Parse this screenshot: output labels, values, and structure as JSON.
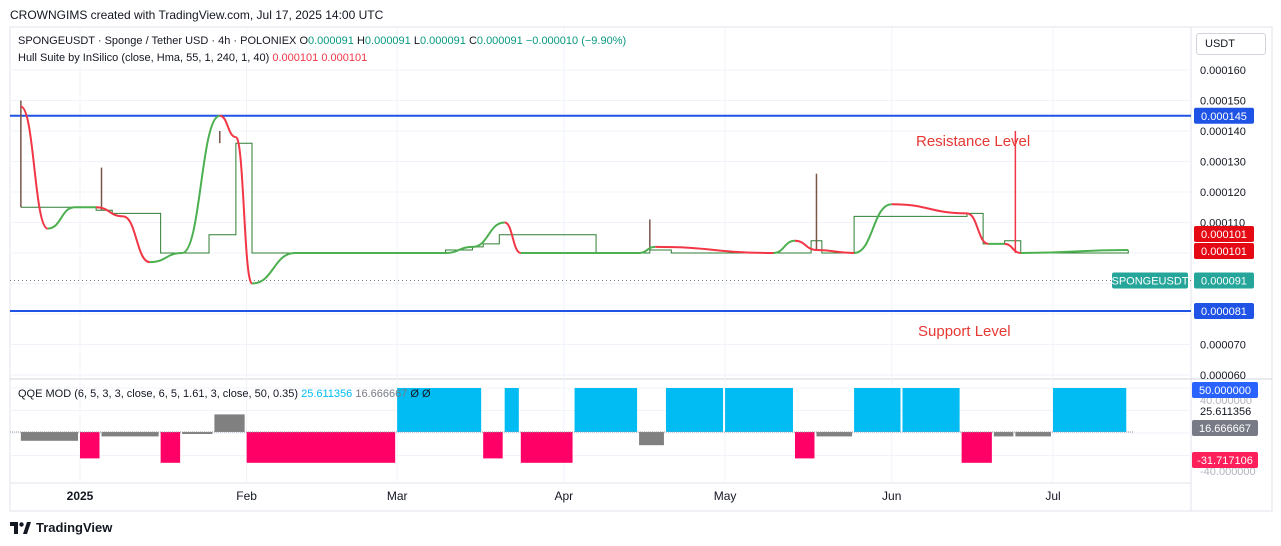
{
  "header": {
    "credit": "CROWNGIMS created with TradingView.com, Jul 17, 2025 14:00 UTC"
  },
  "legend": {
    "symbol": "SPONGEUSDT · Sponge / Tether USD · 4h · POLONIEX",
    "o_label": "O",
    "o": "0.000091",
    "h_label": "H",
    "h": "0.000091",
    "l_label": "L",
    "l": "0.000091",
    "c_label": "C",
    "c": "0.000091",
    "change": "−0.000010 (−9.90%)",
    "hull_name": "Hull Suite by InSilico (close, Hma, 55, 1, 240, 1, 40)",
    "hull_v1": "0.000101",
    "hull_v2": "0.000101",
    "qqe_name": "QQE MOD (6, 5, 3, 3, close, 6, 5, 1.61, 3, close, 50, 0.35)",
    "qqe_v1": "25.611356",
    "qqe_v2": "16.666667",
    "qqe_icons": "Ø Ø"
  },
  "price_axis": {
    "currency": "USDT",
    "ticks": [
      "0.000160",
      "0.000150",
      "0.000140",
      "0.000130",
      "0.000120",
      "0.000110",
      "0.000070",
      "0.000060"
    ],
    "resistance_label": "0.000145",
    "support_label": "0.000081",
    "hull_label1": "0.000101",
    "hull_label2": "0.000101",
    "symbol_tag": "SPONGEUSDT",
    "last_price": "0.000091"
  },
  "annotations": {
    "resistance": "Resistance Level",
    "support": "Support Level"
  },
  "qqe_axis": {
    "top_label": "50.000000",
    "tick1": "25.611356",
    "mid_label": "16.666667",
    "bottom_label": "-31.717106",
    "hidden_tick": "40.000000",
    "hidden_tick2": "-40.000000"
  },
  "time_axis": {
    "labels": [
      "2025",
      "Feb",
      "Mar",
      "Apr",
      "May",
      "Jun",
      "Jul"
    ]
  },
  "footer": {
    "brand": "TradingView"
  },
  "colors": {
    "resistance": "#1e53e5",
    "support": "#1e53e5",
    "hull_up": "#4caf50",
    "hull_down": "#f23645",
    "price_line": "#2e7d32",
    "qqe_blue": "#00bcf2",
    "qqe_pink": "#ff0066",
    "qqe_gray": "#808080",
    "annotation": "#e53935"
  },
  "chart_data": [
    {
      "type": "line",
      "title": "SPONGEUSDT · Sponge / Tether USD · 4h · POLONIEX",
      "ylabel": "USDT",
      "ylim": [
        5.8e-05,
        0.000166
      ],
      "scale_x": [
        "2025",
        "Feb",
        "Mar",
        "Apr",
        "May",
        "Jun",
        "Jul"
      ],
      "levels": [
        {
          "name": "Resistance Level",
          "value": 0.000145
        },
        {
          "name": "Support Level",
          "value": 8.1e-05
        }
      ],
      "series": [
        {
          "name": "SPONGEUSDT",
          "x": [
            "Dec 20",
            "Jan 4",
            "Jan 7",
            "Jan 9",
            "Jan 16",
            "Jan 20",
            "Jan 25",
            "Jan 30",
            "Feb 2",
            "Mar 5",
            "Mar 10",
            "Mar 15",
            "Mar 17",
            "Mar 20",
            "Apr 7",
            "Apr 17",
            "Apr 21",
            "May 10",
            "May 17",
            "May 19",
            "May 25",
            "Jun 15",
            "Jun 18",
            "Jun 22",
            "Jun 25",
            "Jul 15"
          ],
          "values": [
            0.000115,
            0.000114,
            0.000113,
            0.000113,
            0.0001,
            0.0001,
            0.000106,
            0.000136,
            0.0001,
            0.0001,
            0.000101,
            0.000102,
            0.000103,
            0.000106,
            0.0001,
            0.000101,
            0.0001,
            0.0001,
            0.000104,
            0.0001,
            0.000112,
            0.000113,
            0.000103,
            0.000104,
            0.0001,
            0.000101
          ]
        },
        {
          "name": "Hull Suite by InSilico",
          "x": [
            "Dec 20",
            "Dec 25",
            "Dec 30",
            "Jan 4",
            "Jan 9",
            "Jan 14",
            "Jan 20",
            "Jan 27",
            "Jan 30",
            "Feb 2",
            "Feb 10",
            "Mar 1",
            "Mar 10",
            "Mar 15",
            "Mar 21",
            "Mar 24",
            "Apr 1",
            "Apr 15",
            "Apr 18",
            "May 10",
            "May 14",
            "May 18",
            "May 25",
            "Jun 1",
            "Jun 15",
            "Jun 19",
            "Jun 22",
            "Jun 25",
            "Jul 15"
          ],
          "values": [
            0.000148,
            0.000108,
            0.000115,
            0.000115,
            0.000112,
            9.7e-05,
            0.0001,
            0.000145,
            0.000138,
            9e-05,
            0.0001,
            0.0001,
            0.0001,
            0.000102,
            0.00011,
            0.0001,
            0.0001,
            0.0001,
            0.000102,
            0.0001,
            0.000104,
            0.000101,
            0.0001,
            0.000116,
            0.000113,
            0.000103,
            0.000103,
            0.0001,
            0.000101
          ]
        }
      ]
    },
    {
      "type": "bar",
      "title": "QQE MOD (6, 5, 3, 3, close, 6, 5, 1.61, 3, close, 50, 0.35)",
      "ylim": [
        -40,
        50
      ],
      "series": [
        {
          "name": "QQE MOD",
          "x": [
            "Dec 20",
            "Jan 1",
            "Jan 5",
            "Jan 16",
            "Jan 20",
            "Jan 26",
            "Feb 1",
            "Mar 1",
            "Mar 17",
            "Mar 21",
            "Mar 24",
            "Apr 3",
            "Apr 15",
            "Apr 20",
            "May 1",
            "May 14",
            "May 18",
            "May 25",
            "Jun 3",
            "Jun 14",
            "Jun 20",
            "Jun 24",
            "Jul 1",
            "Jul 15"
          ],
          "values": [
            -10,
            -30,
            -5,
            -35,
            0,
            20,
            -35,
            50,
            -30,
            50,
            -35,
            50,
            -15,
            50,
            50,
            -30,
            -5,
            50,
            50,
            -35,
            -5,
            -5,
            50,
            50
          ]
        }
      ]
    }
  ]
}
